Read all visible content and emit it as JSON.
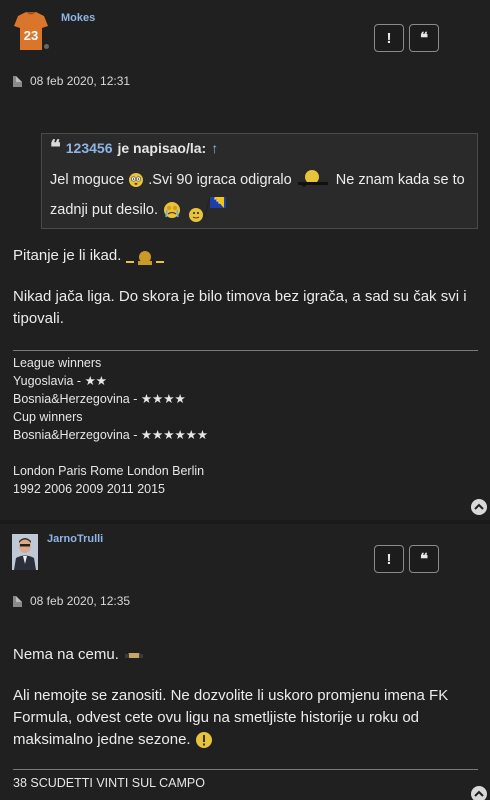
{
  "post1": {
    "username": "Mokes",
    "report_label": "!",
    "quote_label": "❝",
    "date": "08 feb 2020, 12:31",
    "quote": {
      "author": "123456",
      "wrote": "je napisao/la:",
      "up_arrow": "↑",
      "text_a": "Jel moguce",
      "text_b": ".Svi 90 igraca odigralo",
      "text_c": "Ne znam kada se to",
      "text_d": "zadnji put desilo."
    },
    "line1": "Pitanje je li ikad.",
    "line2": "Nikad jača liga. Do skora je bilo timova bez igrača, a sad su čak svi i tipovali.",
    "signature": [
      "League winners",
      "Yugoslavia - ★★",
      "Bosnia&Herzegovina - ★★★★",
      "Cup winners",
      "Bosnia&Herzegovina - ★★★★★★",
      "",
      "London Paris Rome London Berlin",
      "1992 2006 2009 2011 2015"
    ],
    "avatar_number": "23"
  },
  "post2": {
    "username": "JarnoTrulli",
    "report_label": "!",
    "quote_label": "❝",
    "date": "08 feb 2020, 12:35",
    "line1": "Nema na cemu.",
    "line2": "Ali nemojte se zanositi. Ne dozvolite li uskoro promjenu imena FK Formula, odvest cete ovu ligu na smetljiste historije u roku od maksimalno jedne sezone.",
    "signature": "38 SCUDETTI VINTI SUL CAMPO"
  },
  "icons": {
    "back_to_top": "chevron-up-icon",
    "date": "file-icon"
  },
  "colors": {
    "background": "#202020",
    "username": "#8fb4e6",
    "text": "#ececec"
  }
}
